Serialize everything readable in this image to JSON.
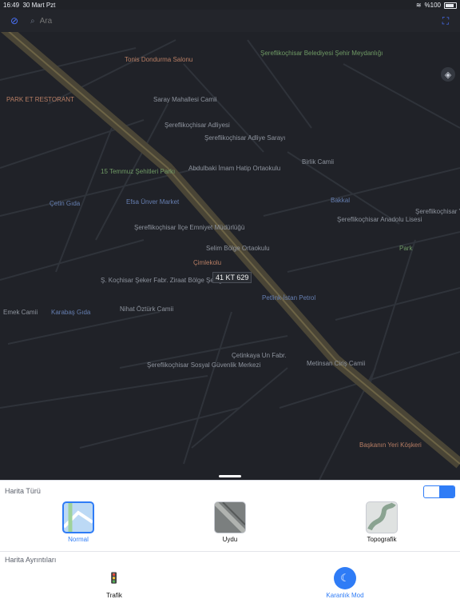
{
  "status": {
    "time": "16:49",
    "date": "30 Mart Pzt",
    "battery": "%100"
  },
  "search": {
    "placeholder": "Ara"
  },
  "map": {
    "plate": "41 KT 629",
    "pois": [
      {
        "name": "Tonis Dondurma Salonu",
        "kind": "food",
        "color": "#b87e64"
      },
      {
        "name": "Şereflikoçhisar Belediyesi Şehir Meydanlığı",
        "kind": "park",
        "color": "#6f9a65"
      },
      {
        "name": "PARK ET RESTORANT",
        "kind": "food",
        "color": "#b87e64"
      },
      {
        "name": "Saray Mahallesi Camii",
        "kind": "mosque",
        "color": "#8e949e"
      },
      {
        "name": "Şereflikoçhisar Adliyesi",
        "kind": "building",
        "color": "#8e949e"
      },
      {
        "name": "Şereflikoçhisar Adliye Sarayı",
        "kind": "building",
        "color": "#8e949e"
      },
      {
        "name": "15 Temmuz Şehitleri Parkı",
        "kind": "park",
        "color": "#6f9a65"
      },
      {
        "name": "Abdulbaki İmam Hatip Ortaokulu",
        "kind": "school",
        "color": "#8e949e"
      },
      {
        "name": "Birlik Camii",
        "kind": "mosque",
        "color": "#8e949e"
      },
      {
        "name": "Çetin Gıda",
        "kind": "store",
        "color": "#667fb1"
      },
      {
        "name": "Efsa Ünver Market",
        "kind": "store",
        "color": "#667fb1"
      },
      {
        "name": "Bakkal",
        "kind": "store",
        "color": "#667fb1"
      },
      {
        "name": "Şereflikoçhisar Anadolu Lisesi",
        "kind": "school",
        "color": "#8e949e"
      },
      {
        "name": "Şereflikoçhisar İlçe Emniyet Müdürlüğü",
        "kind": "building",
        "color": "#8e949e"
      },
      {
        "name": "Selim Bölge Ortaokulu",
        "kind": "school",
        "color": "#8e949e"
      },
      {
        "name": "Çimlekolu",
        "kind": "place",
        "color": "#b87e64"
      },
      {
        "name": "Ş. Koçhisar Şeker Fabr. Ziraat Bölge Şefliği",
        "kind": "building",
        "color": "#8e949e"
      },
      {
        "name": "Petlink-İstan Petrol",
        "kind": "fuel",
        "color": "#667fb1"
      },
      {
        "name": "Emek Camii",
        "kind": "mosque",
        "color": "#8e949e"
      },
      {
        "name": "Karabaş Gıda",
        "kind": "store",
        "color": "#667fb1"
      },
      {
        "name": "Nihat Öztürk Camii",
        "kind": "mosque",
        "color": "#8e949e"
      },
      {
        "name": "Çetinkaya Un Fabr.",
        "kind": "building",
        "color": "#8e949e"
      },
      {
        "name": "Metinsan Ciriş Camii",
        "kind": "mosque",
        "color": "#8e949e"
      },
      {
        "name": "Şereflikoçhisar Sosyal Güvenlik Merkezi",
        "kind": "building",
        "color": "#8e949e"
      },
      {
        "name": "Başkanın Yeri Köşkeri",
        "kind": "food",
        "color": "#b87e64"
      },
      {
        "name": "Şereflikoçhisar Y. Sultan Selim Fen",
        "kind": "school",
        "color": "#8e949e"
      },
      {
        "name": "Park",
        "kind": "park",
        "color": "#6f9a65"
      }
    ]
  },
  "sheet": {
    "map_type_title": "Harita Türü",
    "details_title": "Harita Ayrıntıları",
    "toggle": [
      {
        "label": "",
        "icon": "apple-icon"
      },
      {
        "label": "",
        "icon": "photo-icon"
      }
    ],
    "options": [
      {
        "label": "Normal",
        "selected": true
      },
      {
        "label": "Uydu",
        "selected": false
      },
      {
        "label": "Topografik",
        "selected": false
      }
    ],
    "details": [
      {
        "label": "Trafik",
        "icon": "traffic-light-icon",
        "active": false
      },
      {
        "label": "Karanlık Mod",
        "icon": "moon-icon",
        "active": true
      }
    ]
  }
}
